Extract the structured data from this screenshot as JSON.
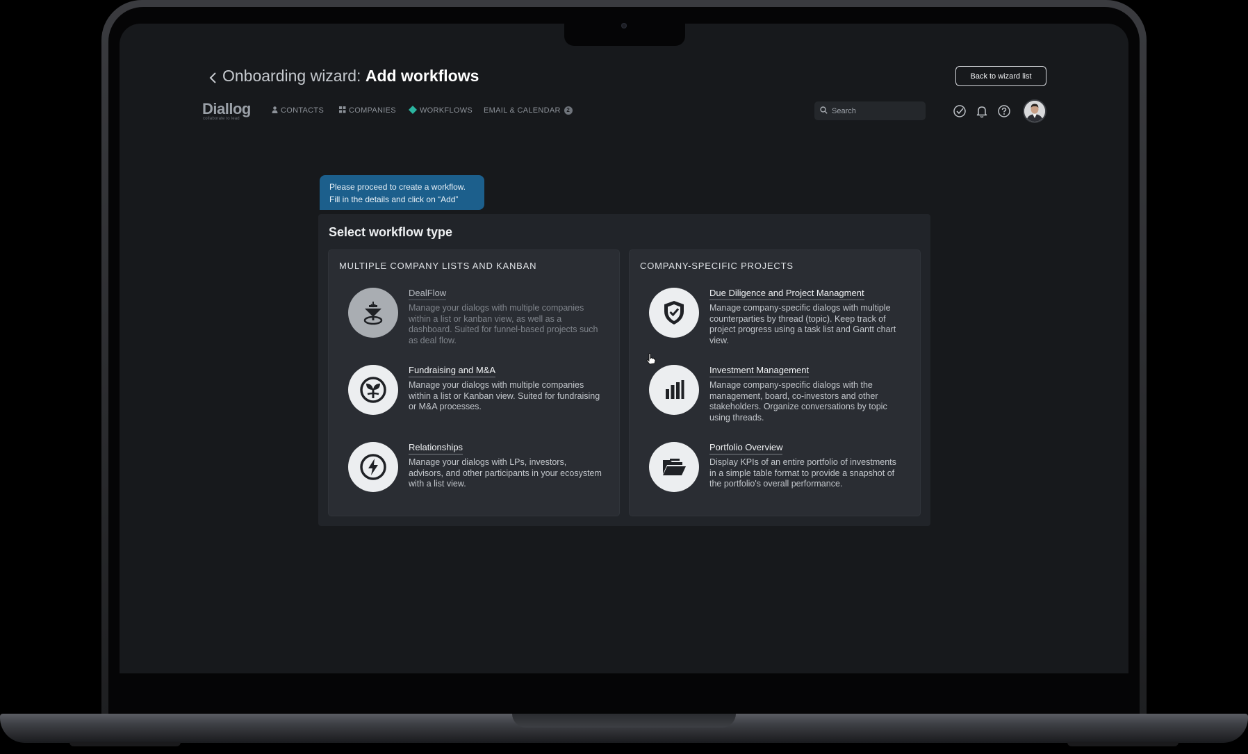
{
  "header": {
    "title_prefix": "Onboarding wizard:",
    "title_main": "Add workflows",
    "back_button_label": "Back to wizard list"
  },
  "brand": {
    "logo_text": "Diallog",
    "tagline": "collaborate to lead"
  },
  "nav": {
    "items": [
      {
        "label": "CONTACTS",
        "icon": "person-icon"
      },
      {
        "label": "COMPANIES",
        "icon": "grid-icon"
      },
      {
        "label": "WORKFLOWS",
        "icon": "diamond-icon",
        "accent": "#2bb5a0"
      },
      {
        "label": "EMAIL & CALENDAR",
        "badge": "2"
      }
    ]
  },
  "search": {
    "placeholder": "Search"
  },
  "header_icons": [
    "check-circle-icon",
    "bell-icon",
    "help-icon"
  ],
  "tip": {
    "line1": "Please proceed to create a workflow.",
    "line2": "Fill in the details and click on “Add”"
  },
  "panel": {
    "title": "Select workflow type",
    "columns": [
      {
        "heading": "MULTIPLE COMPANY LISTS AND KANBAN",
        "items": [
          {
            "name": "DealFlow",
            "icon": "funnel-icon",
            "dimmed": true,
            "description": "Manage your dialogs with multiple companies within a list or kanban view, as well as a dashboard. Suited for funnel-based projects such as deal flow."
          },
          {
            "name": "Fundraising and M&A",
            "icon": "sprout-icon",
            "description": "Manage your dialogs with multiple companies within a list or Kanban view. Suited for fundraising or M&A processes."
          },
          {
            "name": "Relationships",
            "icon": "lightning-icon",
            "description": "Manage your dialogs with LPs, investors, advisors, and other participants in your ecosystem with a list view."
          }
        ]
      },
      {
        "heading": "COMPANY-SPECIFIC PROJECTS",
        "items": [
          {
            "name": "Due Diligence and Project Managment",
            "icon": "shield-check-icon",
            "description": "Manage company-specific dialogs with multiple counterparties by thread (topic). Keep track of project progress using a task list and Gantt chart view."
          },
          {
            "name": "Investment Management",
            "icon": "bar-chart-icon",
            "description": "Manage company-specific dialogs with the management, board, co-investors and other stakeholders. Organize conversations by topic using threads."
          },
          {
            "name": "Portfolio Overview",
            "icon": "folder-icon",
            "description": "Display KPIs of an entire portfolio of investments in a simple table format to provide a snapshot of the portfolio's overall performance."
          }
        ]
      }
    ]
  },
  "colors": {
    "background": "#17191c",
    "panel": "#212429",
    "card": "#2a2d33",
    "tip": "#1c5f8c",
    "accent": "#2bb5a0"
  }
}
